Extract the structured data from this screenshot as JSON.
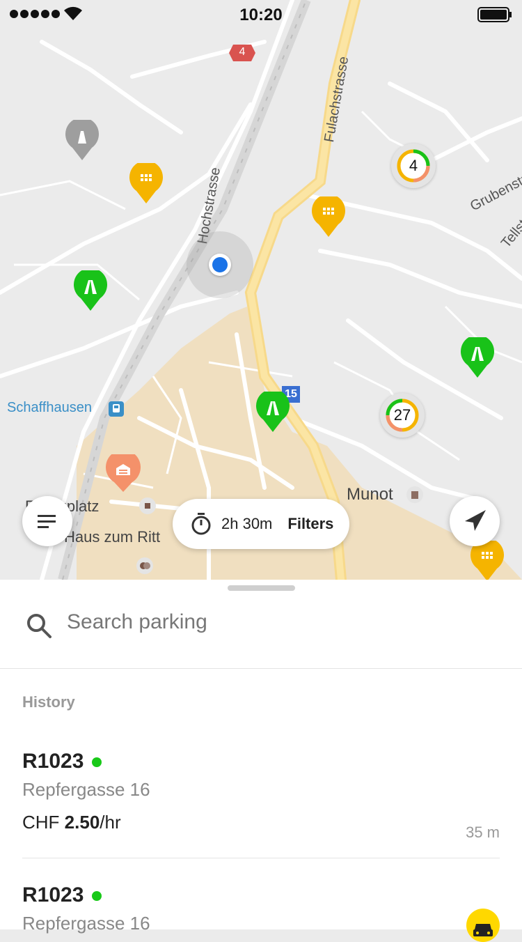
{
  "status_bar": {
    "time": "10:20"
  },
  "map": {
    "streets": {
      "hochstrasse": "Hochstrasse",
      "fulachstrasse": "Fulachstrasse",
      "grubenstrasse": "Grubenstra",
      "tellstrasse": "Tellst",
      "schaffhausen": "Schaffhausen",
      "munot": "Munot",
      "fronwagplatz": "F  wagplatz",
      "haus_zum_ritter": "Haus zum Ritt",
      "road_badge_4": "4",
      "road_badge_15": "15"
    },
    "clusters": [
      {
        "count": "4"
      },
      {
        "count": "27"
      }
    ],
    "colors": {
      "green_pin": "#19c219",
      "orange_pin": "#f5b400",
      "gray_pin": "#9e9e9e",
      "user_dot": "#1a73e8"
    }
  },
  "controls": {
    "menu_icon": "menu-lines-icon",
    "duration": "2h 30m",
    "filters_label": "Filters",
    "locate_icon": "navigation-arrow-icon"
  },
  "sheet": {
    "search_placeholder": "Search parking",
    "history_label": "History",
    "items": [
      {
        "code": "R1023",
        "address": "Repfergasse 16",
        "currency": "CHF",
        "price": "2.50",
        "unit": "/hr",
        "distance": "35 m"
      },
      {
        "code": "R1023",
        "address": "Repfergasse 16"
      }
    ]
  }
}
